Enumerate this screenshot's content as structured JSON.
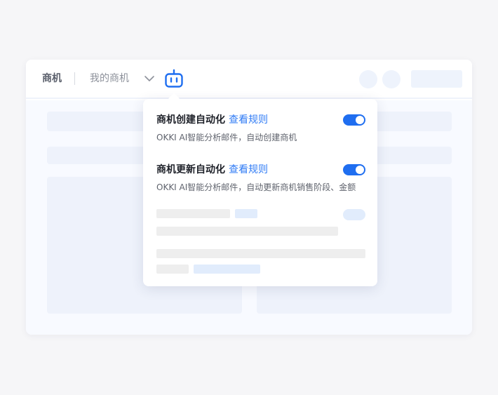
{
  "breadcrumb": {
    "root": "商机",
    "current": "我的商机"
  },
  "icons": {
    "dropdown": "chevron-down-icon",
    "assistant": "robot-icon"
  },
  "colors": {
    "accent": "#1f6ef0",
    "link": "#2f7bf5",
    "title_text": "#1e2129",
    "desc_text": "#5f636d"
  },
  "automation": {
    "rules": [
      {
        "title": "商机创建自动化",
        "link": "查看规则",
        "description": "OKKI AI智能分析邮件，自动创建商机",
        "enabled": true
      },
      {
        "title": "商机更新自动化",
        "link": "查看规则",
        "description": "OKKI AI智能分析邮件，自动更新商机销售阶段、金额",
        "enabled": true
      }
    ]
  }
}
